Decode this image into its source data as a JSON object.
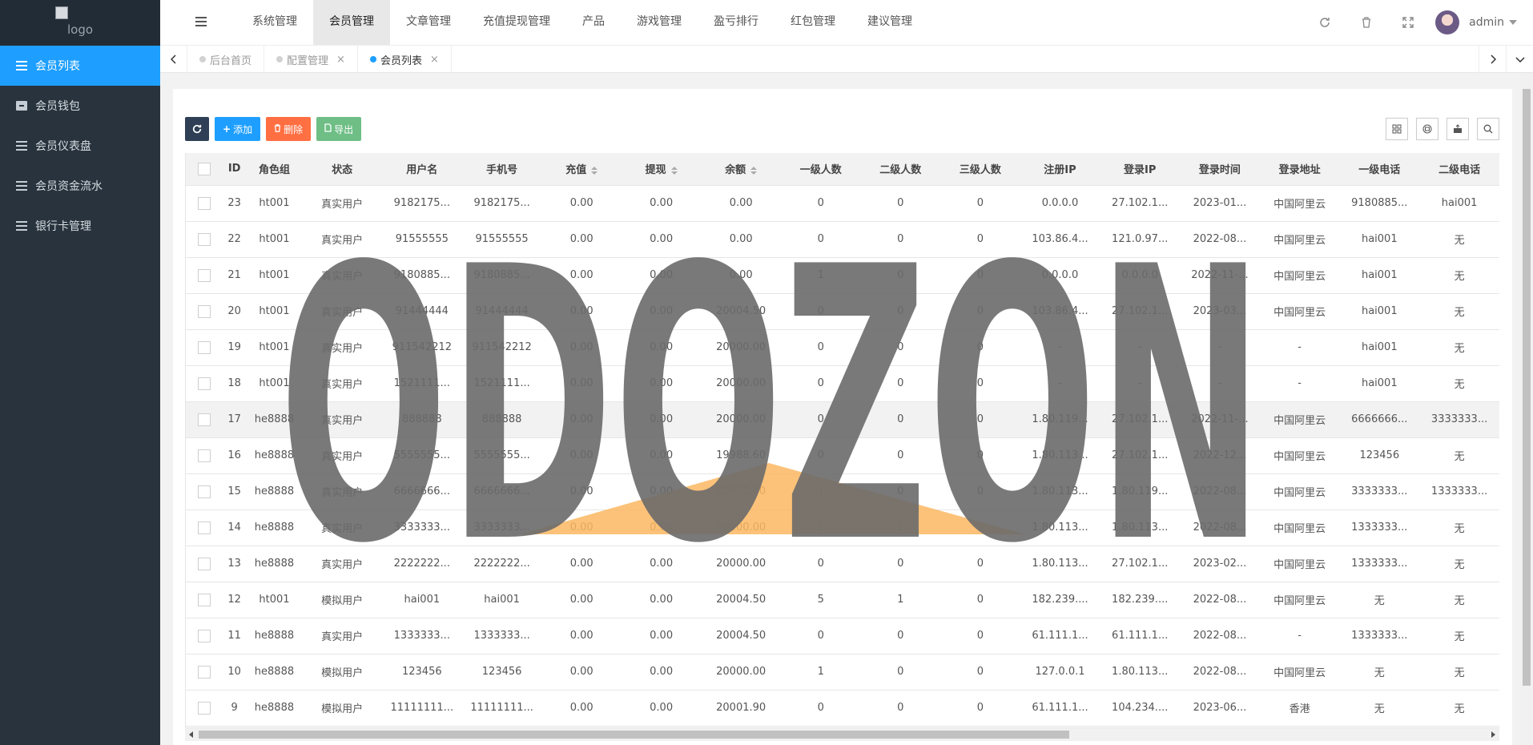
{
  "logo": {
    "alt": "logo"
  },
  "sidebar": {
    "items": [
      {
        "label": "会员列表",
        "icon": "list-icon",
        "active": true
      },
      {
        "label": "会员钱包",
        "icon": "archive-icon",
        "active": false
      },
      {
        "label": "会员仪表盘",
        "icon": "scale-icon",
        "active": false
      },
      {
        "label": "会员资金流水",
        "icon": "list-icon",
        "active": false
      },
      {
        "label": "银行卡管理",
        "icon": "list-icon",
        "active": false
      }
    ]
  },
  "topnav": {
    "items": [
      "系统管理",
      "会员管理",
      "文章管理",
      "充值提现管理",
      "产品",
      "游戏管理",
      "盈亏排行",
      "红包管理",
      "建议管理"
    ],
    "active_index": 1,
    "user": "admin"
  },
  "tabs": [
    {
      "label": "后台首页",
      "closable": false,
      "active": false
    },
    {
      "label": "配置管理",
      "closable": true,
      "active": false
    },
    {
      "label": "会员列表",
      "closable": true,
      "active": true
    }
  ],
  "toolbar": {
    "add_label": "添加",
    "delete_label": "删除",
    "export_label": "导出"
  },
  "table": {
    "columns": [
      "ID",
      "角色组",
      "状态",
      "用户名",
      "手机号",
      "充值",
      "提现",
      "余额",
      "一级人数",
      "二级人数",
      "三级人数",
      "注册IP",
      "登录IP",
      "登录时间",
      "登录地址",
      "一级电话",
      "二级电话"
    ],
    "rows": [
      [
        "23",
        "ht001",
        "真实用户",
        "9182175...",
        "9182175...",
        "0.00",
        "0.00",
        "0.00",
        "0",
        "0",
        "0",
        "0.0.0.0",
        "27.102.1...",
        "2023-01...",
        "中国阿里云",
        "9180885...",
        "hai001"
      ],
      [
        "22",
        "ht001",
        "真实用户",
        "91555555",
        "91555555",
        "0.00",
        "0.00",
        "0.00",
        "0",
        "0",
        "0",
        "103.86.4...",
        "121.0.97...",
        "2022-08...",
        "中国阿里云",
        "hai001",
        "无"
      ],
      [
        "21",
        "ht001",
        "真实用户",
        "9180885...",
        "9180885...",
        "0.00",
        "0.00",
        "0.00",
        "1",
        "0",
        "0",
        "0.0.0.0",
        "0.0.0.0",
        "2022-11-...",
        "中国阿里云",
        "hai001",
        "无"
      ],
      [
        "20",
        "ht001",
        "真实用户",
        "91444444",
        "91444444",
        "0.00",
        "0.00",
        "20004.50",
        "0",
        "0",
        "0",
        "103.86.4...",
        "27.102.1...",
        "2023-03...",
        "中国阿里云",
        "hai001",
        "无"
      ],
      [
        "19",
        "ht001",
        "真实用户",
        "911542212",
        "911542212",
        "0.00",
        "0.00",
        "20000.00",
        "0",
        "0",
        "0",
        "-",
        "-",
        "-",
        "-",
        "hai001",
        "无"
      ],
      [
        "18",
        "ht001",
        "真实用户",
        "1521111...",
        "1521111...",
        "0.00",
        "0.00",
        "20000.00",
        "0",
        "0",
        "0",
        "-",
        "-",
        "-",
        "-",
        "hai001",
        "无"
      ],
      [
        "17",
        "he8888",
        "真实用户",
        "888888",
        "888888",
        "0.00",
        "0.00",
        "20000.00",
        "0",
        "0",
        "0",
        "1.80.119...",
        "27.102.1...",
        "2022-11-...",
        "中国阿里云",
        "6666666...",
        "3333333..."
      ],
      [
        "16",
        "he8888",
        "真实用户",
        "5555555...",
        "5555555...",
        "0.00",
        "0.00",
        "19988.60",
        "0",
        "0",
        "0",
        "1.80.113...",
        "27.102.1...",
        "2022-12...",
        "中国阿里云",
        "123456",
        "无"
      ],
      [
        "15",
        "he8888",
        "真实用户",
        "6666666...",
        "6666666...",
        "0.00",
        "0.00",
        "20000.00",
        "1",
        "0",
        "0",
        "1.80.113...",
        "1.80.119...",
        "2022-08...",
        "中国阿里云",
        "3333333...",
        "1333333..."
      ],
      [
        "14",
        "he8888",
        "真实用户",
        "3333333...",
        "3333333...",
        "0.00",
        "0.00",
        "20000.00",
        "1",
        "1",
        "0",
        "1.80.113...",
        "1.80.113...",
        "2022-08...",
        "中国阿里云",
        "1333333...",
        "无"
      ],
      [
        "13",
        "he8888",
        "真实用户",
        "2222222...",
        "2222222...",
        "0.00",
        "0.00",
        "20000.00",
        "0",
        "0",
        "0",
        "1.80.113...",
        "27.102.1...",
        "2023-02...",
        "中国阿里云",
        "1333333...",
        "无"
      ],
      [
        "12",
        "ht001",
        "模拟用户",
        "hai001",
        "hai001",
        "0.00",
        "0.00",
        "20004.50",
        "5",
        "1",
        "0",
        "182.239....",
        "182.239....",
        "2022-08...",
        "中国阿里云",
        "无",
        "无"
      ],
      [
        "11",
        "he8888",
        "真实用户",
        "1333333...",
        "1333333...",
        "0.00",
        "0.00",
        "20004.50",
        "0",
        "0",
        "0",
        "61.111.1...",
        "61.111.1...",
        "2022-08...",
        "-",
        "1333333...",
        "无"
      ],
      [
        "10",
        "he8888",
        "模拟用户",
        "123456",
        "123456",
        "0.00",
        "0.00",
        "20000.00",
        "1",
        "0",
        "0",
        "127.0.0.1",
        "1.80.113...",
        "2022-08...",
        "中国阿里云",
        "无",
        "无"
      ],
      [
        "9",
        "he8888",
        "模拟用户",
        "11111111...",
        "11111111...",
        "0.00",
        "0.00",
        "20001.90",
        "0",
        "0",
        "0",
        "61.111.1...",
        "104.234....",
        "2023-06...",
        "香港",
        "无",
        "无"
      ]
    ],
    "highlight_row": 6
  },
  "watermark": {
    "text": "ODOZON",
    "accent": "#fcb762",
    "color": "#6b6b6b"
  }
}
